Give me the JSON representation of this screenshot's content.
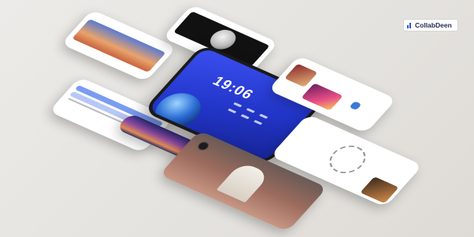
{
  "brand": {
    "name": "CollabDeen",
    "accent": "#2d55d8"
  },
  "phone": {
    "time": "19:06"
  },
  "icons": {
    "brand_logo": "bar-chart-icon"
  }
}
